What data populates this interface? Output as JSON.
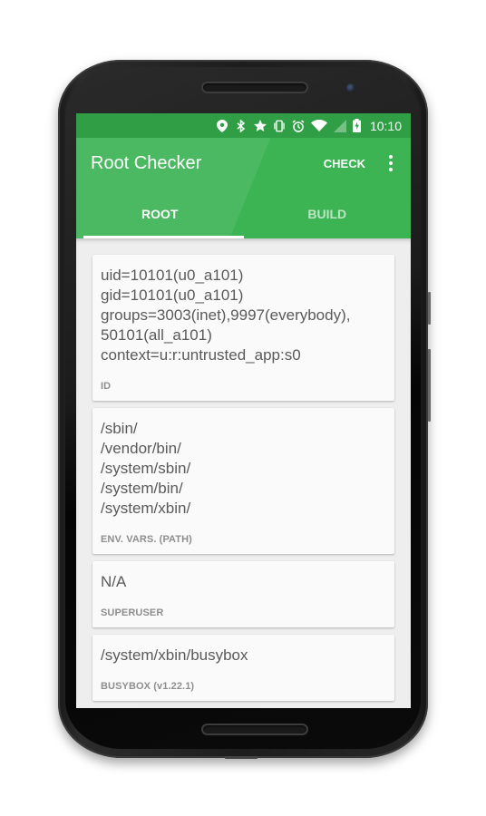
{
  "statusbar": {
    "icons": [
      "location-icon",
      "bluetooth-icon",
      "star-icon",
      "vibrate-icon",
      "alarm-icon",
      "wifi-icon",
      "cell-signal-icon",
      "battery-charging-icon"
    ],
    "time": "10:10"
  },
  "app": {
    "title": "Root Checker",
    "check_label": "CHECK",
    "overflow_icon": "more-vert-icon",
    "accent_color": "#3cb454",
    "status_color": "#2f9e44"
  },
  "tabs": [
    {
      "label": "ROOT",
      "active": true
    },
    {
      "label": "BUILD",
      "active": false
    }
  ],
  "cards": [
    {
      "value": "uid=10101(u0_a101)\ngid=10101(u0_a101)\ngroups=3003(inet),9997(everybody),\n50101(all_a101)\ncontext=u:r:untrusted_app:s0",
      "label": "ID"
    },
    {
      "value": "/sbin/\n/vendor/bin/\n/system/sbin/\n/system/bin/\n/system/xbin/",
      "label": "ENV. VARS. (PATH)"
    },
    {
      "value": "N/A",
      "label": "SUPERUSER"
    },
    {
      "value": "/system/xbin/busybox",
      "label": "BUSYBOX (v1.22.1)"
    }
  ]
}
